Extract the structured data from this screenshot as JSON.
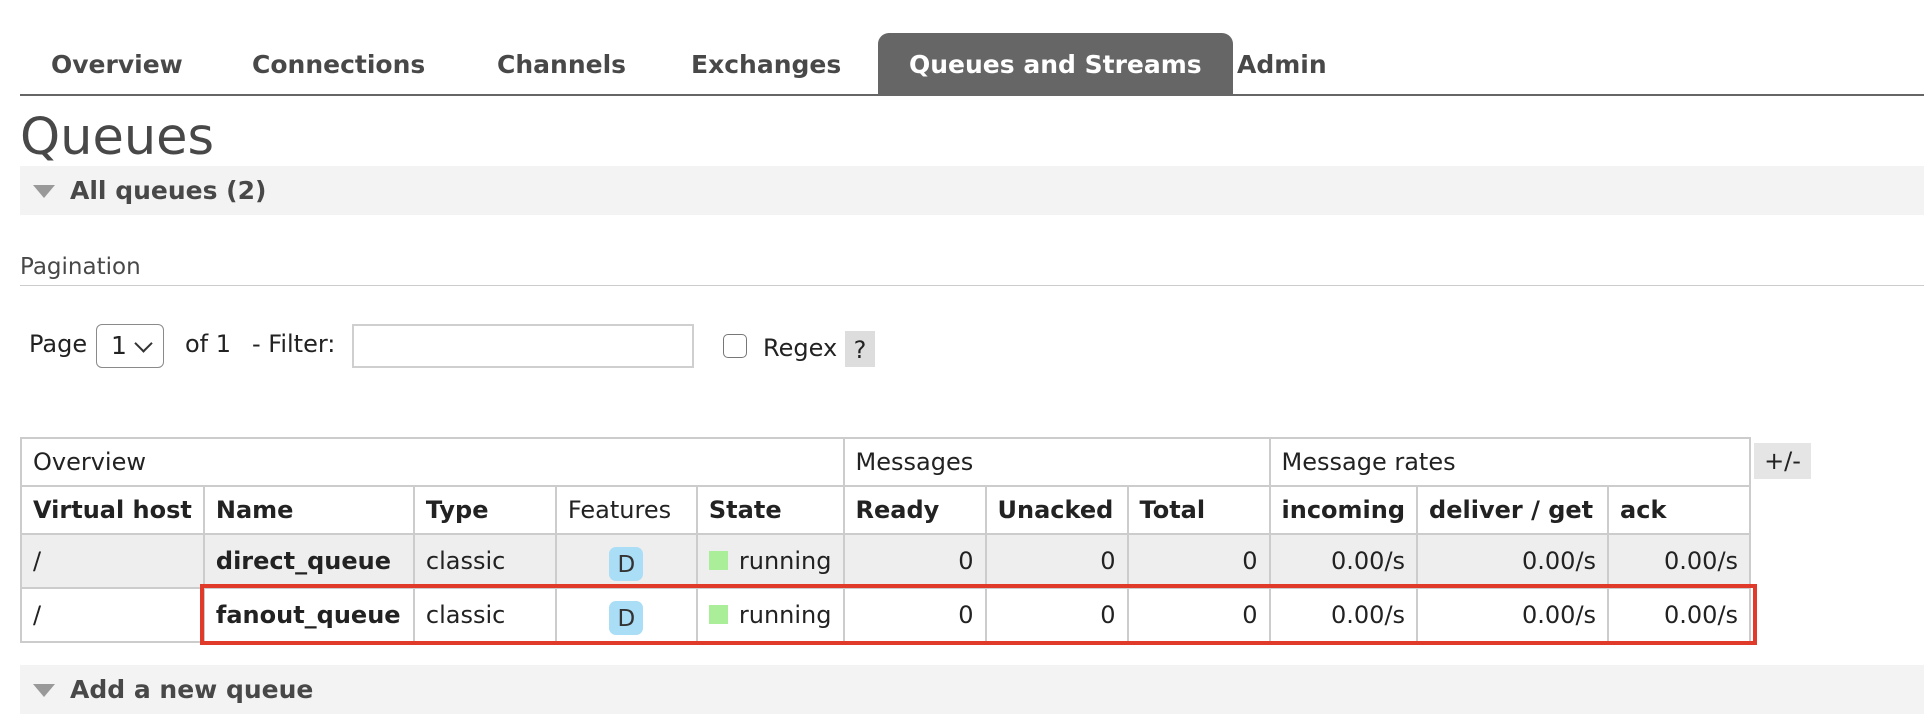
{
  "nav": {
    "tabs": [
      {
        "label": "Overview",
        "active": false
      },
      {
        "label": "Connections",
        "active": false
      },
      {
        "label": "Channels",
        "active": false
      },
      {
        "label": "Exchanges",
        "active": false
      },
      {
        "label": "Queues and Streams",
        "active": true
      },
      {
        "label": "Admin",
        "active": false
      }
    ]
  },
  "page": {
    "title": "Queues",
    "all_queues_header": "All queues (2)",
    "add_queue_header": "Add a new queue"
  },
  "pagination": {
    "title": "Pagination",
    "page_label": "Page",
    "page_value": "1",
    "of_label": "of 1",
    "filter_label": "- Filter:",
    "filter_value": "",
    "regex_label": "Regex",
    "regex_checked": false,
    "help_label": "?"
  },
  "table": {
    "groups": [
      "Overview",
      "Messages",
      "Message rates"
    ],
    "columns_toggle": "+/-",
    "columns": [
      "Virtual host",
      "Name",
      "Type",
      "Features",
      "State",
      "Ready",
      "Unacked",
      "Total",
      "incoming",
      "deliver / get",
      "ack"
    ],
    "rows": [
      {
        "vhost": "/",
        "name": "direct_queue",
        "type": "classic",
        "features": "D",
        "state": "running",
        "ready": "0",
        "unacked": "0",
        "total": "0",
        "incoming": "0.00/s",
        "deliver_get": "0.00/s",
        "ack": "0.00/s",
        "highlighted": false
      },
      {
        "vhost": "/",
        "name": "fanout_queue",
        "type": "classic",
        "features": "D",
        "state": "running",
        "ready": "0",
        "unacked": "0",
        "total": "0",
        "incoming": "0.00/s",
        "deliver_get": "0.00/s",
        "ack": "0.00/s",
        "highlighted": true
      }
    ]
  },
  "colors": {
    "active_tab_bg": "#666666",
    "state_running": "#aaee99",
    "feature_badge": "#aaddf6",
    "highlight_border": "#e03a2a"
  }
}
